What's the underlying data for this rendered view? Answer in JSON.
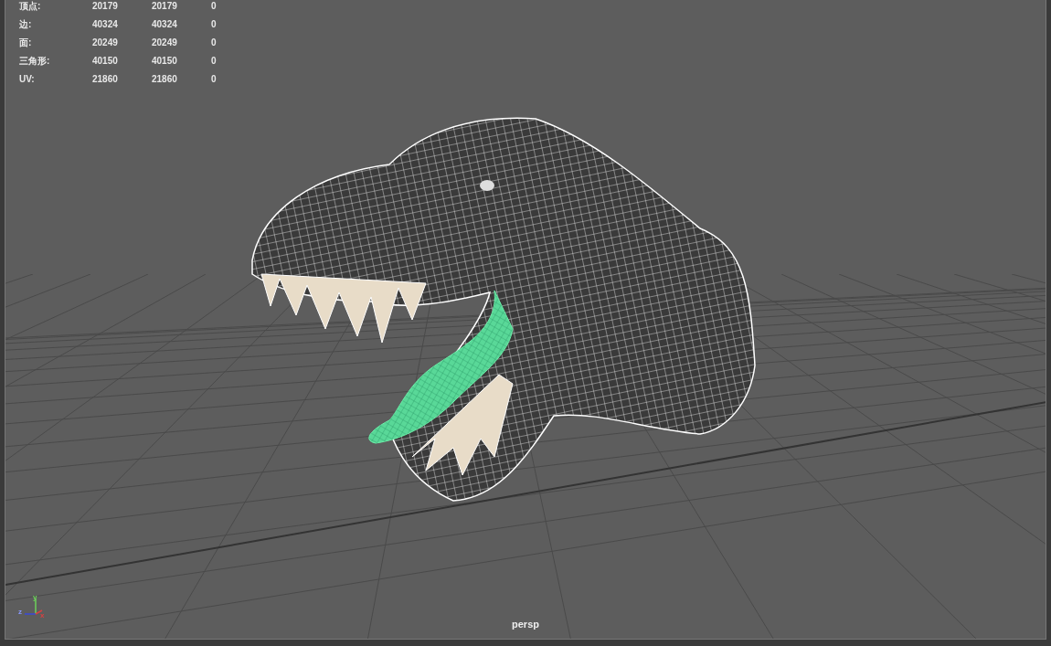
{
  "hud": {
    "rows": [
      {
        "label": "顶点:",
        "values": [
          "20179",
          "20179",
          "0"
        ]
      },
      {
        "label": "边:",
        "values": [
          "40324",
          "40324",
          "0"
        ]
      },
      {
        "label": "面:",
        "values": [
          "20249",
          "20249",
          "0"
        ]
      },
      {
        "label": "三角形:",
        "values": [
          "40150",
          "40150",
          "0"
        ]
      },
      {
        "label": "UV:",
        "values": [
          "21860",
          "21860",
          "0"
        ]
      }
    ]
  },
  "axis_gizmo": {
    "y": "y",
    "z": "z",
    "x": "x"
  },
  "camera_label": "persp"
}
